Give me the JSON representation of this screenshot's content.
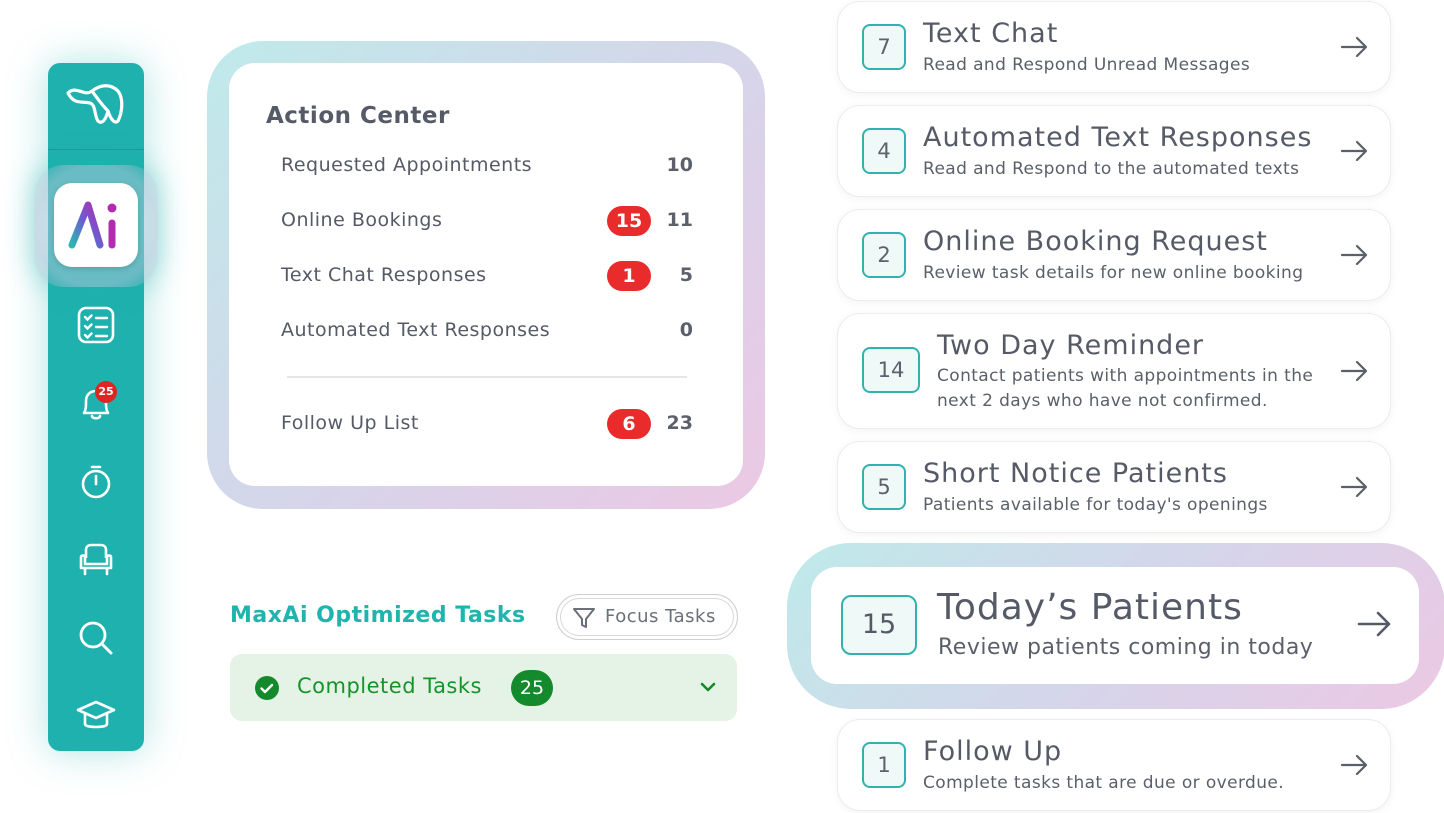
{
  "colors": {
    "teal": "#1fb1ad",
    "badge_red": "#ea2b2b",
    "completed_green": "#17932b",
    "completed_bg": "#e4f3e6"
  },
  "sidebar": {
    "logo_icon": "tooth-logo-icon",
    "active_app_icon": "maxai-logo-icon",
    "items": [
      {
        "icon": "task-list-icon"
      },
      {
        "icon": "bell-icon",
        "badge": "25"
      },
      {
        "icon": "stopwatch-icon"
      },
      {
        "icon": "dental-chair-icon"
      },
      {
        "icon": "search-icon"
      },
      {
        "icon": "graduation-cap-icon"
      }
    ]
  },
  "action_center": {
    "title": "Action Center",
    "rows": [
      {
        "label": "Requested Appointments",
        "count": "10"
      },
      {
        "label": "Online Bookings",
        "badge": "15",
        "count": "11"
      },
      {
        "label": "Text Chat Responses",
        "badge": "1",
        "count": "5"
      },
      {
        "label": "Automated Text Responses",
        "count": "0"
      }
    ],
    "follow_up": {
      "label": "Follow Up List",
      "badge": "6",
      "count": "23"
    }
  },
  "optimized_tasks": {
    "title": "MaxAi Optimized Tasks",
    "focus_button": "Focus Tasks",
    "completed": {
      "label": "Completed Tasks",
      "count": "25"
    }
  },
  "tasks": [
    {
      "num": "7",
      "title": "Text Chat",
      "subtitle": "Read and Respond Unread Messages"
    },
    {
      "num": "4",
      "title": "Automated Text Responses",
      "subtitle": "Read and Respond to the automated texts"
    },
    {
      "num": "2",
      "title": "Online Booking Request",
      "subtitle": "Review task details for new online booking"
    },
    {
      "num": "14",
      "title": "Two Day Reminder",
      "subtitle": "Contact patients with appointments in the next 2 days who have not confirmed."
    },
    {
      "num": "5",
      "title": "Short Notice Patients",
      "subtitle": "Patients available for today's openings"
    },
    {
      "num": "15",
      "title": "Today’s Patients",
      "subtitle": "Review patients coming in today"
    },
    {
      "num": "1",
      "title": "Follow Up",
      "subtitle": "Complete tasks that are due or overdue."
    }
  ]
}
